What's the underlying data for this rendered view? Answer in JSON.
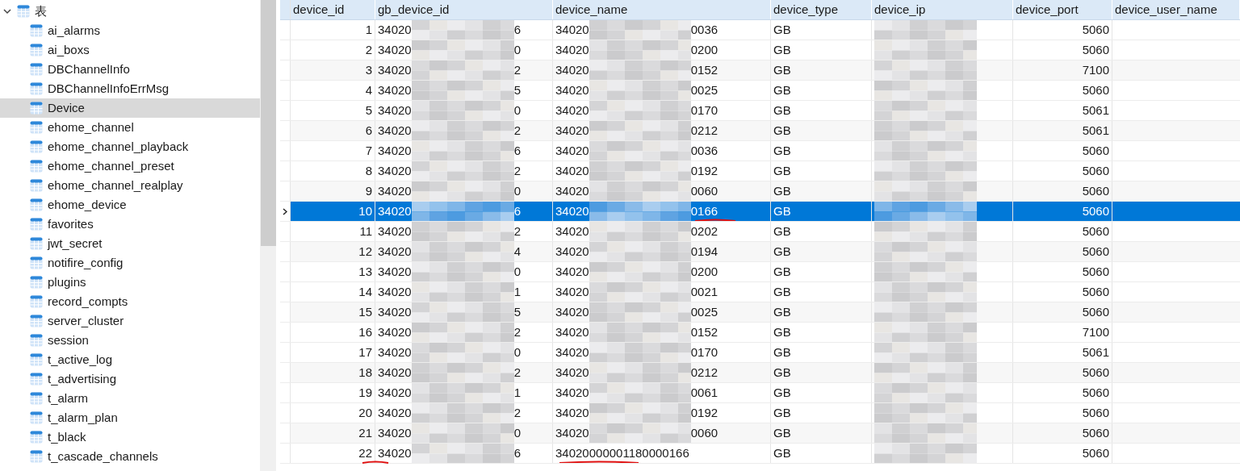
{
  "sidebar": {
    "root": {
      "label": "表",
      "expanded": true,
      "children": [
        {
          "label": "ai_alarms",
          "selected": false
        },
        {
          "label": "ai_boxs",
          "selected": false
        },
        {
          "label": "DBChannelInfo",
          "selected": false
        },
        {
          "label": "DBChannelInfoErrMsg",
          "selected": false
        },
        {
          "label": "Device",
          "selected": true
        },
        {
          "label": "ehome_channel",
          "selected": false
        },
        {
          "label": "ehome_channel_playback",
          "selected": false
        },
        {
          "label": "ehome_channel_preset",
          "selected": false
        },
        {
          "label": "ehome_channel_realplay",
          "selected": false
        },
        {
          "label": "ehome_device",
          "selected": false
        },
        {
          "label": "favorites",
          "selected": false
        },
        {
          "label": "jwt_secret",
          "selected": false
        },
        {
          "label": "notifire_config",
          "selected": false
        },
        {
          "label": "plugins",
          "selected": false
        },
        {
          "label": "record_compts",
          "selected": false
        },
        {
          "label": "server_cluster",
          "selected": false
        },
        {
          "label": "session",
          "selected": false
        },
        {
          "label": "t_active_log",
          "selected": false
        },
        {
          "label": "t_advertising",
          "selected": false
        },
        {
          "label": "t_alarm",
          "selected": false
        },
        {
          "label": "t_alarm_plan",
          "selected": false
        },
        {
          "label": "t_black",
          "selected": false
        },
        {
          "label": "t_cascade_channels",
          "selected": false
        }
      ]
    }
  },
  "table": {
    "columns": [
      "device_id",
      "gb_device_id",
      "device_name",
      "device_type",
      "device_ip",
      "device_port",
      "device_user_name"
    ],
    "rows": [
      {
        "device_id": "1",
        "gb_device_id": {
          "start": "34020",
          "end": "6"
        },
        "device_name": {
          "start": "34020",
          "end": "0036"
        },
        "device_type": "GB",
        "device_port": "5060",
        "selected": false,
        "id_underlined": false,
        "name_underlined": false
      },
      {
        "device_id": "2",
        "gb_device_id": {
          "start": "34020",
          "end": "0"
        },
        "device_name": {
          "start": "34020",
          "end": "0200"
        },
        "device_type": "GB",
        "device_port": "5060",
        "selected": false,
        "id_underlined": false,
        "name_underlined": false
      },
      {
        "device_id": "3",
        "gb_device_id": {
          "start": "34020",
          "end": "2"
        },
        "device_name": {
          "start": "34020",
          "end": "0152"
        },
        "device_type": "GB",
        "device_port": "7100",
        "selected": false,
        "id_underlined": false,
        "name_underlined": false
      },
      {
        "device_id": "4",
        "gb_device_id": {
          "start": "34020",
          "end": "5"
        },
        "device_name": {
          "start": "34020",
          "end": "0025"
        },
        "device_type": "GB",
        "device_port": "5060",
        "selected": false,
        "id_underlined": false,
        "name_underlined": false
      },
      {
        "device_id": "5",
        "gb_device_id": {
          "start": "34020",
          "end": "0"
        },
        "device_name": {
          "start": "34020",
          "end": "0170"
        },
        "device_type": "GB",
        "device_port": "5061",
        "selected": false,
        "id_underlined": false,
        "name_underlined": false
      },
      {
        "device_id": "6",
        "gb_device_id": {
          "start": "34020",
          "end": "2"
        },
        "device_name": {
          "start": "34020",
          "end": "0212"
        },
        "device_type": "GB",
        "device_port": "5061",
        "selected": false,
        "id_underlined": false,
        "name_underlined": false
      },
      {
        "device_id": "7",
        "gb_device_id": {
          "start": "34020",
          "end": "6"
        },
        "device_name": {
          "start": "34020",
          "end": "0036"
        },
        "device_type": "GB",
        "device_port": "5060",
        "selected": false,
        "id_underlined": false,
        "name_underlined": false
      },
      {
        "device_id": "8",
        "gb_device_id": {
          "start": "34020",
          "end": "2"
        },
        "device_name": {
          "start": "34020",
          "end": "0192"
        },
        "device_type": "GB",
        "device_port": "5060",
        "selected": false,
        "id_underlined": false,
        "name_underlined": false
      },
      {
        "device_id": "9",
        "gb_device_id": {
          "start": "34020",
          "end": "0"
        },
        "device_name": {
          "start": "34020",
          "end": "0060"
        },
        "device_type": "GB",
        "device_port": "5060",
        "selected": false,
        "id_underlined": false,
        "name_underlined": false
      },
      {
        "device_id": "10",
        "gb_device_id": {
          "start": "34020",
          "end": "6"
        },
        "device_name": {
          "start": "34020",
          "end": "0166"
        },
        "device_type": "GB",
        "device_port": "5060",
        "selected": true,
        "id_underlined": false,
        "name_underlined": true
      },
      {
        "device_id": "11",
        "gb_device_id": {
          "start": "34020",
          "end": "2"
        },
        "device_name": {
          "start": "34020",
          "end": "0202"
        },
        "device_type": "GB",
        "device_port": "5060",
        "selected": false,
        "id_underlined": false,
        "name_underlined": false
      },
      {
        "device_id": "12",
        "gb_device_id": {
          "start": "34020",
          "end": "4"
        },
        "device_name": {
          "start": "34020",
          "end": "0194"
        },
        "device_type": "GB",
        "device_port": "5060",
        "selected": false,
        "id_underlined": false,
        "name_underlined": false
      },
      {
        "device_id": "13",
        "gb_device_id": {
          "start": "34020",
          "end": "0"
        },
        "device_name": {
          "start": "34020",
          "end": "0200"
        },
        "device_type": "GB",
        "device_port": "5060",
        "selected": false,
        "id_underlined": false,
        "name_underlined": false
      },
      {
        "device_id": "14",
        "gb_device_id": {
          "start": "34020",
          "end": "1"
        },
        "device_name": {
          "start": "34020",
          "end": "0021"
        },
        "device_type": "GB",
        "device_port": "5060",
        "selected": false,
        "id_underlined": false,
        "name_underlined": false
      },
      {
        "device_id": "15",
        "gb_device_id": {
          "start": "34020",
          "end": "5"
        },
        "device_name": {
          "start": "34020",
          "end": "0025"
        },
        "device_type": "GB",
        "device_port": "5060",
        "selected": false,
        "id_underlined": false,
        "name_underlined": false
      },
      {
        "device_id": "16",
        "gb_device_id": {
          "start": "34020",
          "end": "2"
        },
        "device_name": {
          "start": "34020",
          "end": "0152"
        },
        "device_type": "GB",
        "device_port": "7100",
        "selected": false,
        "id_underlined": false,
        "name_underlined": false
      },
      {
        "device_id": "17",
        "gb_device_id": {
          "start": "34020",
          "end": "0"
        },
        "device_name": {
          "start": "34020",
          "end": "0170"
        },
        "device_type": "GB",
        "device_port": "5061",
        "selected": false,
        "id_underlined": false,
        "name_underlined": false
      },
      {
        "device_id": "18",
        "gb_device_id": {
          "start": "34020",
          "end": "2"
        },
        "device_name": {
          "start": "34020",
          "end": "0212"
        },
        "device_type": "GB",
        "device_port": "5060",
        "selected": false,
        "id_underlined": false,
        "name_underlined": false
      },
      {
        "device_id": "19",
        "gb_device_id": {
          "start": "34020",
          "end": "1"
        },
        "device_name": {
          "start": "34020",
          "end": "0061"
        },
        "device_type": "GB",
        "device_port": "5060",
        "selected": false,
        "id_underlined": false,
        "name_underlined": false
      },
      {
        "device_id": "20",
        "gb_device_id": {
          "start": "34020",
          "end": "2"
        },
        "device_name": {
          "start": "34020",
          "end": "0192"
        },
        "device_type": "GB",
        "device_port": "5060",
        "selected": false,
        "id_underlined": false,
        "name_underlined": false
      },
      {
        "device_id": "21",
        "gb_device_id": {
          "start": "34020",
          "end": "0"
        },
        "device_name": {
          "start": "34020",
          "end": "0060"
        },
        "device_type": "GB",
        "device_port": "5060",
        "selected": false,
        "id_underlined": false,
        "name_underlined": false
      },
      {
        "device_id": "22",
        "gb_device_id": {
          "start": "34020",
          "end": "6"
        },
        "device_name": {
          "text": "34020000001180000166"
        },
        "device_type": "GB",
        "device_port": "5060",
        "selected": false,
        "id_underlined": true,
        "name_underlined": true
      }
    ]
  }
}
